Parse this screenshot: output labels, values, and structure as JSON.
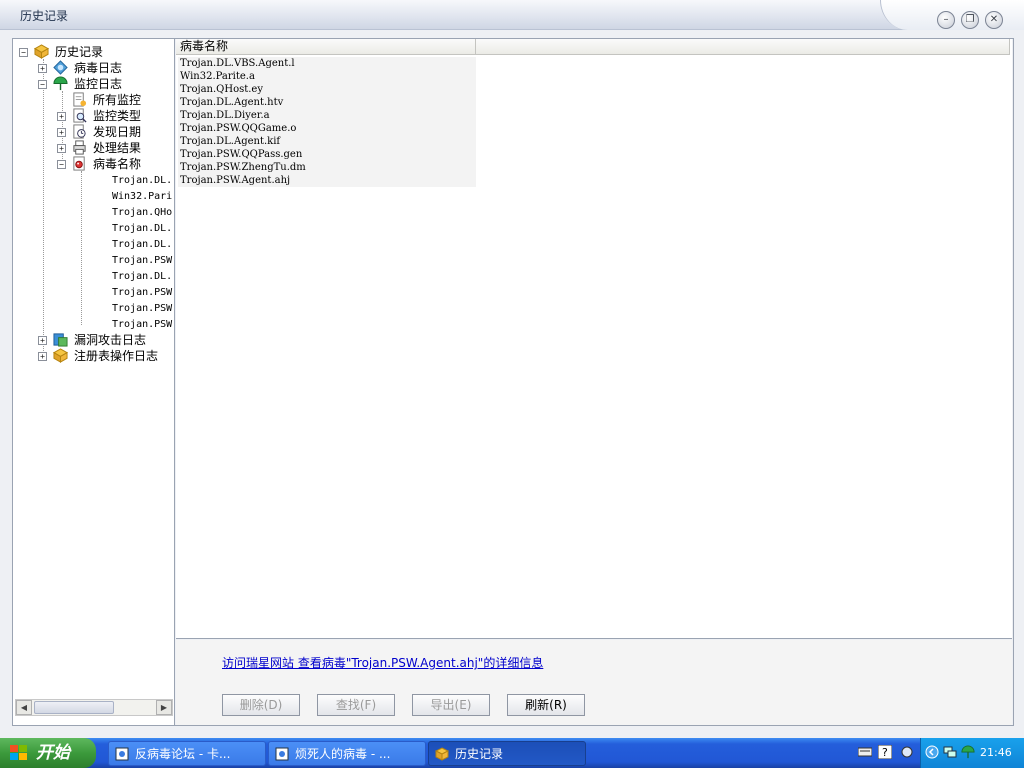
{
  "window": {
    "title": "历史记录"
  },
  "tree": {
    "root": "历史记录",
    "virus_log": "病毒日志",
    "monitor_log": "监控日志",
    "all_monitor": "所有监控",
    "monitor_type": "监控类型",
    "found_date": "发现日期",
    "handle_result": "处理结果",
    "virus_name": "病毒名称",
    "leaves": [
      "Trojan.DL.",
      "Win32.Pari",
      "Trojan.QHo",
      "Trojan.DL.",
      "Trojan.DL.",
      "Trojan.PSW",
      "Trojan.DL.",
      "Trojan.PSW",
      "Trojan.PSW",
      "Trojan.PSW"
    ],
    "exploit_log": "漏洞攻击日志",
    "registry_log": "注册表操作日志"
  },
  "list": {
    "column_header": "病毒名称",
    "rows": [
      "Trojan.DL.VBS.Agent.l",
      "Win32.Parite.a",
      "Trojan.QHost.ey",
      "Trojan.DL.Agent.htv",
      "Trojan.DL.Diyer.a",
      "Trojan.PSW.QQGame.o",
      "Trojan.DL.Agent.kif",
      "Trojan.PSW.QQPass.gen",
      "Trojan.PSW.ZhengTu.dm",
      "Trojan.PSW.Agent.ahj"
    ]
  },
  "bottom": {
    "link": "访问瑞星网站 查看病毒\"Trojan.PSW.Agent.ahj\"的详细信息",
    "delete": "删除(D)",
    "find": "查找(F)",
    "export": "导出(E)",
    "refresh": "刷新(R)"
  },
  "taskbar": {
    "start": "开始",
    "tasks": [
      "反病毒论坛 - 卡...",
      "烦死人的病毒 - ...",
      "历史记录"
    ],
    "clock": "21:46"
  },
  "icons": {
    "minimize": "minimize-icon",
    "restore": "restore-icon",
    "close": "close-icon"
  }
}
